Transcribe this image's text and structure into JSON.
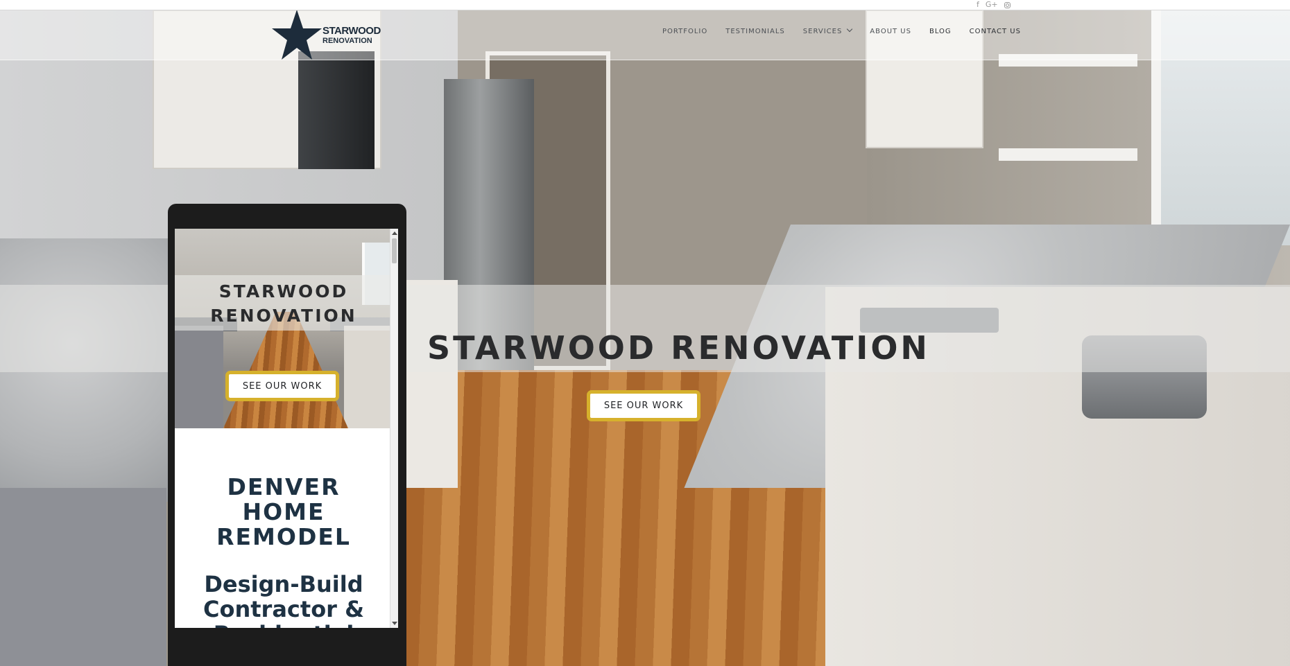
{
  "social": {
    "icons": [
      "facebook-icon",
      "google-plus-icon",
      "instagram-icon"
    ],
    "facebook": "f",
    "google": "G+"
  },
  "brand": {
    "line1": "STARWOOD",
    "line2": "RENOVATION",
    "star_color": "#1d2c3b"
  },
  "nav": {
    "items": [
      {
        "label": "PORTFOLIO"
      },
      {
        "label": "TESTIMONIALS"
      },
      {
        "label": "SERVICES"
      },
      {
        "label": "ABOUT US"
      },
      {
        "label": "BLOG"
      },
      {
        "label": "CONTACT US"
      }
    ]
  },
  "hero": {
    "title": "STARWOOD RENOVATION",
    "cta_label": "SEE OUR WORK",
    "cta_border_color": "#d6b12c"
  },
  "mobile": {
    "title_line1": "STARWOOD",
    "title_line2": "RENOVATION",
    "cta_label": "SEE OUR WORK",
    "heading_line1": "DENVER",
    "heading_line2": "HOME",
    "heading_line3": "REMODEL",
    "sub_line1": "Design-Build",
    "sub_line2": "Contractor &",
    "sub_line3": "Residential",
    "heading_color": "#1e3243"
  }
}
